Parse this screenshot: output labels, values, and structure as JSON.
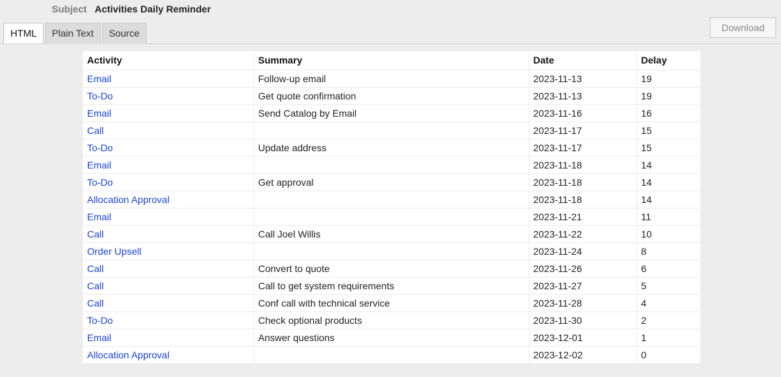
{
  "subject": {
    "label": "Subject",
    "value": "Activities Daily Reminder"
  },
  "tabs": [
    {
      "label": "HTML",
      "active": true
    },
    {
      "label": "Plain Text",
      "active": false
    },
    {
      "label": "Source",
      "active": false
    }
  ],
  "download_label": "Download",
  "table": {
    "headers": [
      "Activity",
      "Summary",
      "Date",
      "Delay"
    ],
    "rows": [
      {
        "activity": "Email",
        "summary": "Follow-up email",
        "date": "2023-11-13",
        "delay": "19"
      },
      {
        "activity": "To-Do",
        "summary": "Get quote confirmation",
        "date": "2023-11-13",
        "delay": "19"
      },
      {
        "activity": "Email",
        "summary": "Send Catalog by Email",
        "date": "2023-11-16",
        "delay": "16"
      },
      {
        "activity": "Call",
        "summary": "",
        "date": "2023-11-17",
        "delay": "15"
      },
      {
        "activity": "To-Do",
        "summary": "Update address",
        "date": "2023-11-17",
        "delay": "15"
      },
      {
        "activity": "Email",
        "summary": "",
        "date": "2023-11-18",
        "delay": "14"
      },
      {
        "activity": "To-Do",
        "summary": "Get approval",
        "date": "2023-11-18",
        "delay": "14"
      },
      {
        "activity": "Allocation Approval",
        "summary": "",
        "date": "2023-11-18",
        "delay": "14"
      },
      {
        "activity": "Email",
        "summary": "",
        "date": "2023-11-21",
        "delay": "11"
      },
      {
        "activity": "Call",
        "summary": "Call Joel Willis",
        "date": "2023-11-22",
        "delay": "10"
      },
      {
        "activity": "Order Upsell",
        "summary": "",
        "date": "2023-11-24",
        "delay": "8"
      },
      {
        "activity": "Call",
        "summary": "Convert to quote",
        "date": "2023-11-26",
        "delay": "6"
      },
      {
        "activity": "Call",
        "summary": "Call to get system requirements",
        "date": "2023-11-27",
        "delay": "5"
      },
      {
        "activity": "Call",
        "summary": "Conf call with technical service",
        "date": "2023-11-28",
        "delay": "4"
      },
      {
        "activity": "To-Do",
        "summary": "Check optional products",
        "date": "2023-11-30",
        "delay": "2"
      },
      {
        "activity": "Email",
        "summary": "Answer questions",
        "date": "2023-12-01",
        "delay": "1"
      },
      {
        "activity": "Allocation Approval",
        "summary": "",
        "date": "2023-12-02",
        "delay": "0"
      }
    ]
  }
}
